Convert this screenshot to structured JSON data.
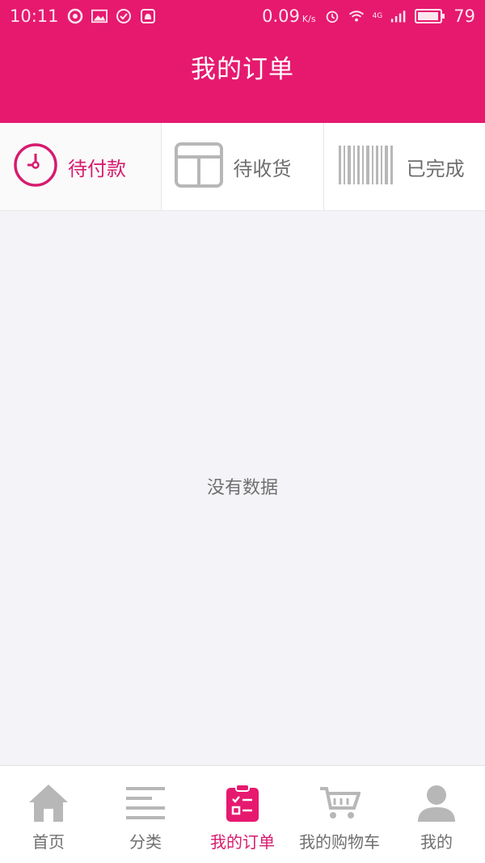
{
  "status_bar": {
    "time": "10:11",
    "speed": "0.09",
    "speed_unit": "K/s",
    "network": "4G",
    "battery": "79"
  },
  "header": {
    "title": "我的订单"
  },
  "tabs": [
    {
      "label": "待付款",
      "icon": "clock-icon",
      "active": true
    },
    {
      "label": "待收货",
      "icon": "grid-icon",
      "active": false
    },
    {
      "label": "已完成",
      "icon": "barcode-icon",
      "active": false
    }
  ],
  "main": {
    "empty_text": "没有数据"
  },
  "bottom_nav": [
    {
      "label": "首页",
      "icon": "home-icon",
      "active": false
    },
    {
      "label": "分类",
      "icon": "menu-icon",
      "active": false
    },
    {
      "label": "我的订单",
      "icon": "order-icon",
      "active": true
    },
    {
      "label": "我的购物车",
      "icon": "cart-icon",
      "active": false
    },
    {
      "label": "我的",
      "icon": "user-icon",
      "active": false
    }
  ],
  "colors": {
    "accent": "#e6196f",
    "accent_text": "#d71b6e",
    "inactive_icon": "#b7b7b7"
  }
}
